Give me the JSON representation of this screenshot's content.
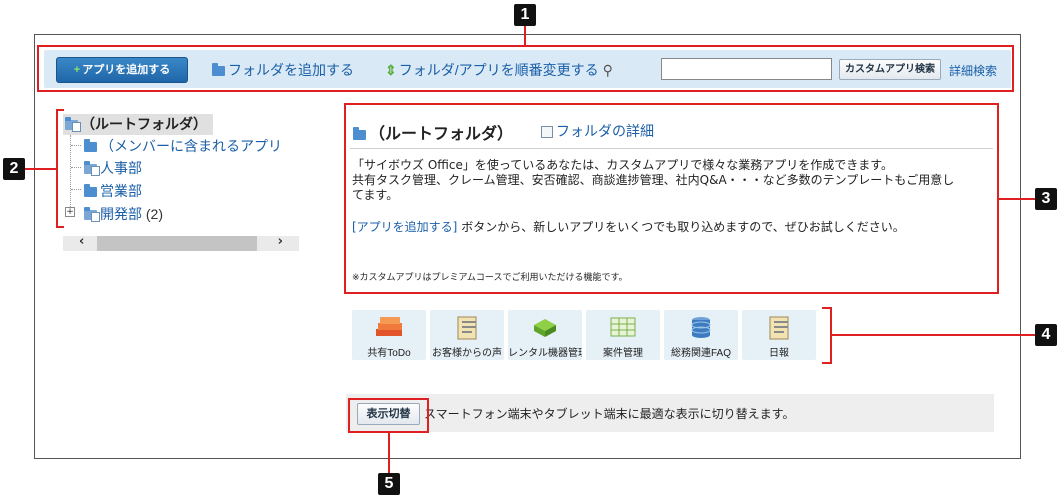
{
  "toolbar": {
    "add_app_label": "アプリを追加する",
    "add_folder_label": "フォルダを追加する",
    "reorder_label": "フォルダ/アプリを順番変更する",
    "search_value": "",
    "search_button_label": "カスタムアプリ検索",
    "advanced_search_label": "詳細検索"
  },
  "tree": {
    "root": "（ルートフォルダ）",
    "items": [
      {
        "label": "（メンバーに含まれるアプリ"
      },
      {
        "label": "人事部"
      },
      {
        "label": "営業部"
      },
      {
        "label": "開発部",
        "count": "(2)"
      }
    ]
  },
  "panel": {
    "title": "（ルートフォルダ）",
    "detail_link": "フォルダの詳細",
    "desc_line1": "「サイボウズ Office」を使っているあなたは、カスタムアプリで様々な業務アプリを作成できます。",
    "desc_line2": "共有タスク管理、クレーム管理、安否確認、商談進捗管理、社内Q&A・・・など多数のテンプレートもご用意し",
    "desc_line3": "てます。",
    "add_link": "[アプリを追加する]",
    "add_text": " ボタンから、新しいアプリをいくつでも取り込めますので、ぜひお試しください。",
    "note": "※カスタムアプリはプレミアムコースでご利用いただける機能です。"
  },
  "apps": [
    {
      "label": "共有ToDo",
      "icon": "stack-icon"
    },
    {
      "label": "お客様からの声",
      "icon": "notepad-icon"
    },
    {
      "label": "レンタル機器管理",
      "icon": "block-icon"
    },
    {
      "label": "案件管理",
      "icon": "spreadsheet-icon"
    },
    {
      "label": "総務関連FAQ",
      "icon": "database-icon"
    },
    {
      "label": "日報",
      "icon": "notepad-icon"
    }
  ],
  "mobile": {
    "switch_label": "表示切替",
    "text": "スマートフォン端末やタブレット端末に最適な表示に切り替えます。"
  },
  "annotations": {
    "badge1": "1",
    "badge2": "2",
    "badge3": "3",
    "badge4": "4",
    "badge5": "5"
  },
  "colors": {
    "annotation_red": "#e02020",
    "toolbar_bg": "#d9e9f5",
    "link_blue": "#1a5fa8",
    "primary_button": "#1f66a8"
  }
}
